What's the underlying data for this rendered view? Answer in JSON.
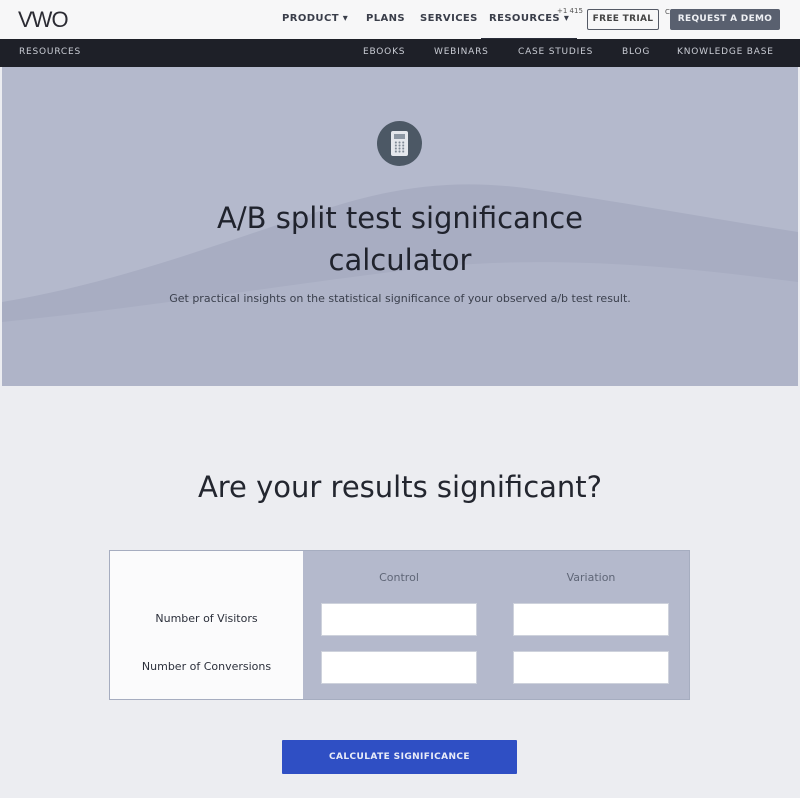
{
  "header": {
    "logo": "VWO",
    "nav": [
      "PRODUCT ▾",
      "PLANS",
      "SERVICES",
      "RESOURCES ▾"
    ],
    "phone": "+1 415",
    "small_link": "CO",
    "free_trial": "FREE TRIAL",
    "request_demo": "REQUEST A DEMO"
  },
  "subnav": {
    "title": "RESOURCES",
    "items": [
      "EBOOKS",
      "WEBINARS",
      "CASE STUDIES",
      "BLOG",
      "KNOWLEDGE BASE"
    ]
  },
  "hero": {
    "icon": "calculator-icon",
    "title_line1": "A/B split test significance",
    "title_line2": "calculator",
    "subtitle": "Get practical insights on the statistical significance of your observed a/b test result."
  },
  "calculator": {
    "heading": "Are your results significant?",
    "columns": [
      "Control",
      "Variation"
    ],
    "rows": [
      "Number of Visitors",
      "Number of Conversions"
    ],
    "inputs": {
      "control_visitors": "",
      "variation_visitors": "",
      "control_conversions": "",
      "variation_conversions": ""
    },
    "button": "CALCULATE SIGNIFICANCE"
  },
  "colors": {
    "hero_bg": "#b4b9cc",
    "subnav_bg": "#1e2028",
    "button_bg": "#2f4fc4",
    "demo_button_bg": "#59606f"
  }
}
